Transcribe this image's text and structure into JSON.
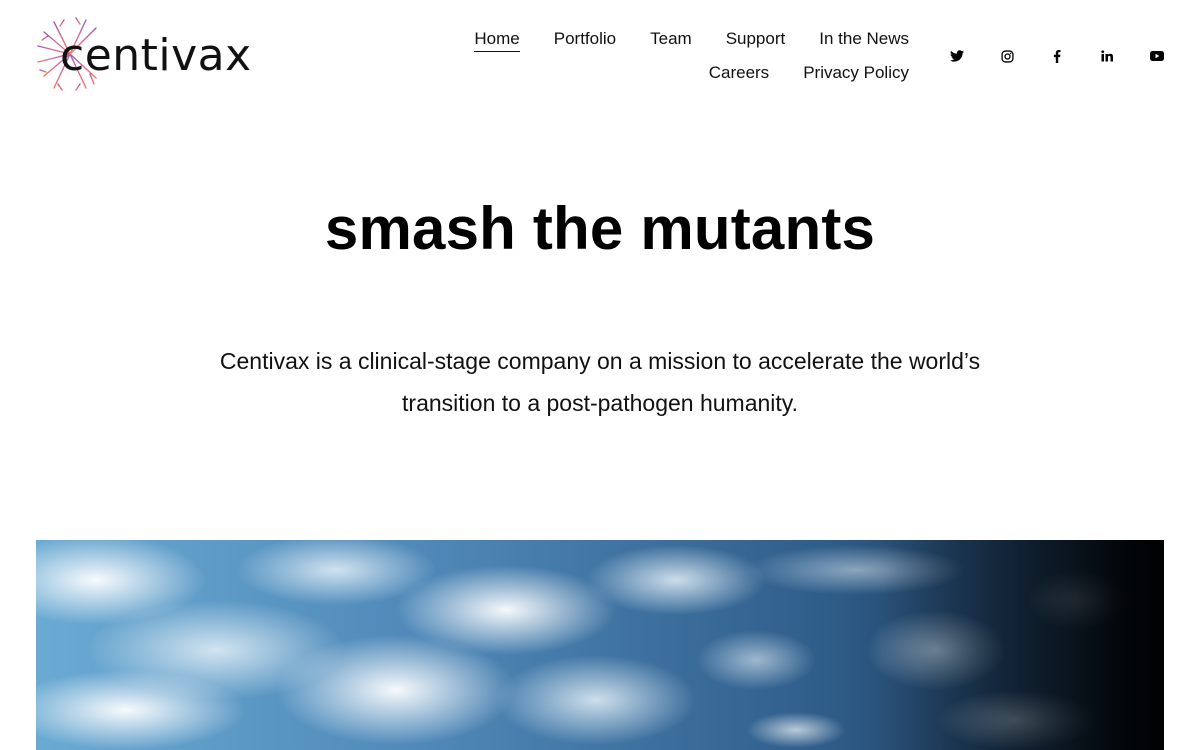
{
  "brand": {
    "name": "centivax",
    "logo_icon": "centivax-tree-logo"
  },
  "nav": {
    "items": [
      {
        "label": "Home",
        "active": true
      },
      {
        "label": "Portfolio"
      },
      {
        "label": "Team"
      },
      {
        "label": "Support"
      },
      {
        "label": "In the News"
      },
      {
        "label": "Careers"
      },
      {
        "label": "Privacy Policy"
      }
    ]
  },
  "social": [
    {
      "icon": "twitter-icon"
    },
    {
      "icon": "instagram-icon"
    },
    {
      "icon": "facebook-icon"
    },
    {
      "icon": "linkedin-icon"
    },
    {
      "icon": "youtube-icon"
    }
  ],
  "hero": {
    "title": "smash the mutants",
    "subtitle": "Centivax is a clinical-stage company on a mission to accelerate the world’s transition to a post-pathogen humanity."
  },
  "banner": {
    "image": "earth-from-space-clouds-image"
  },
  "colors": {
    "logo_top": "#9b59b6",
    "logo_bottom": "#e8735a",
    "text": "#111111",
    "background": "#ffffff"
  }
}
